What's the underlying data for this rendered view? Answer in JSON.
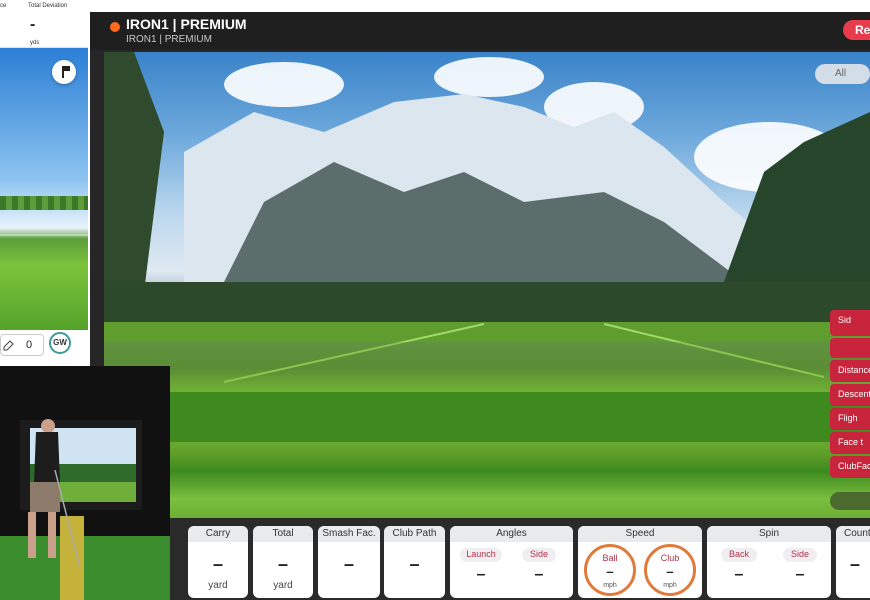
{
  "left_panel": {
    "stats_labels": [
      "ce",
      "Total Deviation"
    ],
    "total_deviation_value": "-",
    "total_deviation_unit": "yds",
    "counter_value": "0",
    "club_badge": "GW"
  },
  "header": {
    "title": "IRON1 | PREMIUM",
    "subtitle": "IRON1 | PREMIUM",
    "record_label": "Re"
  },
  "scene": {
    "filter_label": "All"
  },
  "side_metrics": [
    "Sid",
    "Distance T",
    "Descent",
    "Fligh",
    "Face t",
    "ClubFace"
  ],
  "metrics": {
    "carry": {
      "label": "Carry",
      "value": "–",
      "unit": "yard"
    },
    "total": {
      "label": "Total",
      "value": "–",
      "unit": "yard"
    },
    "smash": {
      "label": "Smash Fac.",
      "value": "–"
    },
    "club_path": {
      "label": "Club Path",
      "value": "–"
    },
    "angles": {
      "label": "Angles",
      "launch_label": "Launch",
      "launch_value": "–",
      "side_label": "Side",
      "side_value": "–"
    },
    "speed": {
      "label": "Speed",
      "ball_label": "Ball",
      "ball_value": "–",
      "ball_unit": "mph",
      "club_label": "Club",
      "club_value": "–",
      "club_unit": "mph"
    },
    "spin": {
      "label": "Spin",
      "back_label": "Back",
      "back_value": "–",
      "side_label": "Side",
      "side_value": "–"
    },
    "count": {
      "label": "Count",
      "value": "–"
    }
  },
  "colors": {
    "accent": "#c8243b",
    "record": "#e83c4d",
    "ring": "#e07a3a",
    "status_dot": "#ff6a1a"
  }
}
